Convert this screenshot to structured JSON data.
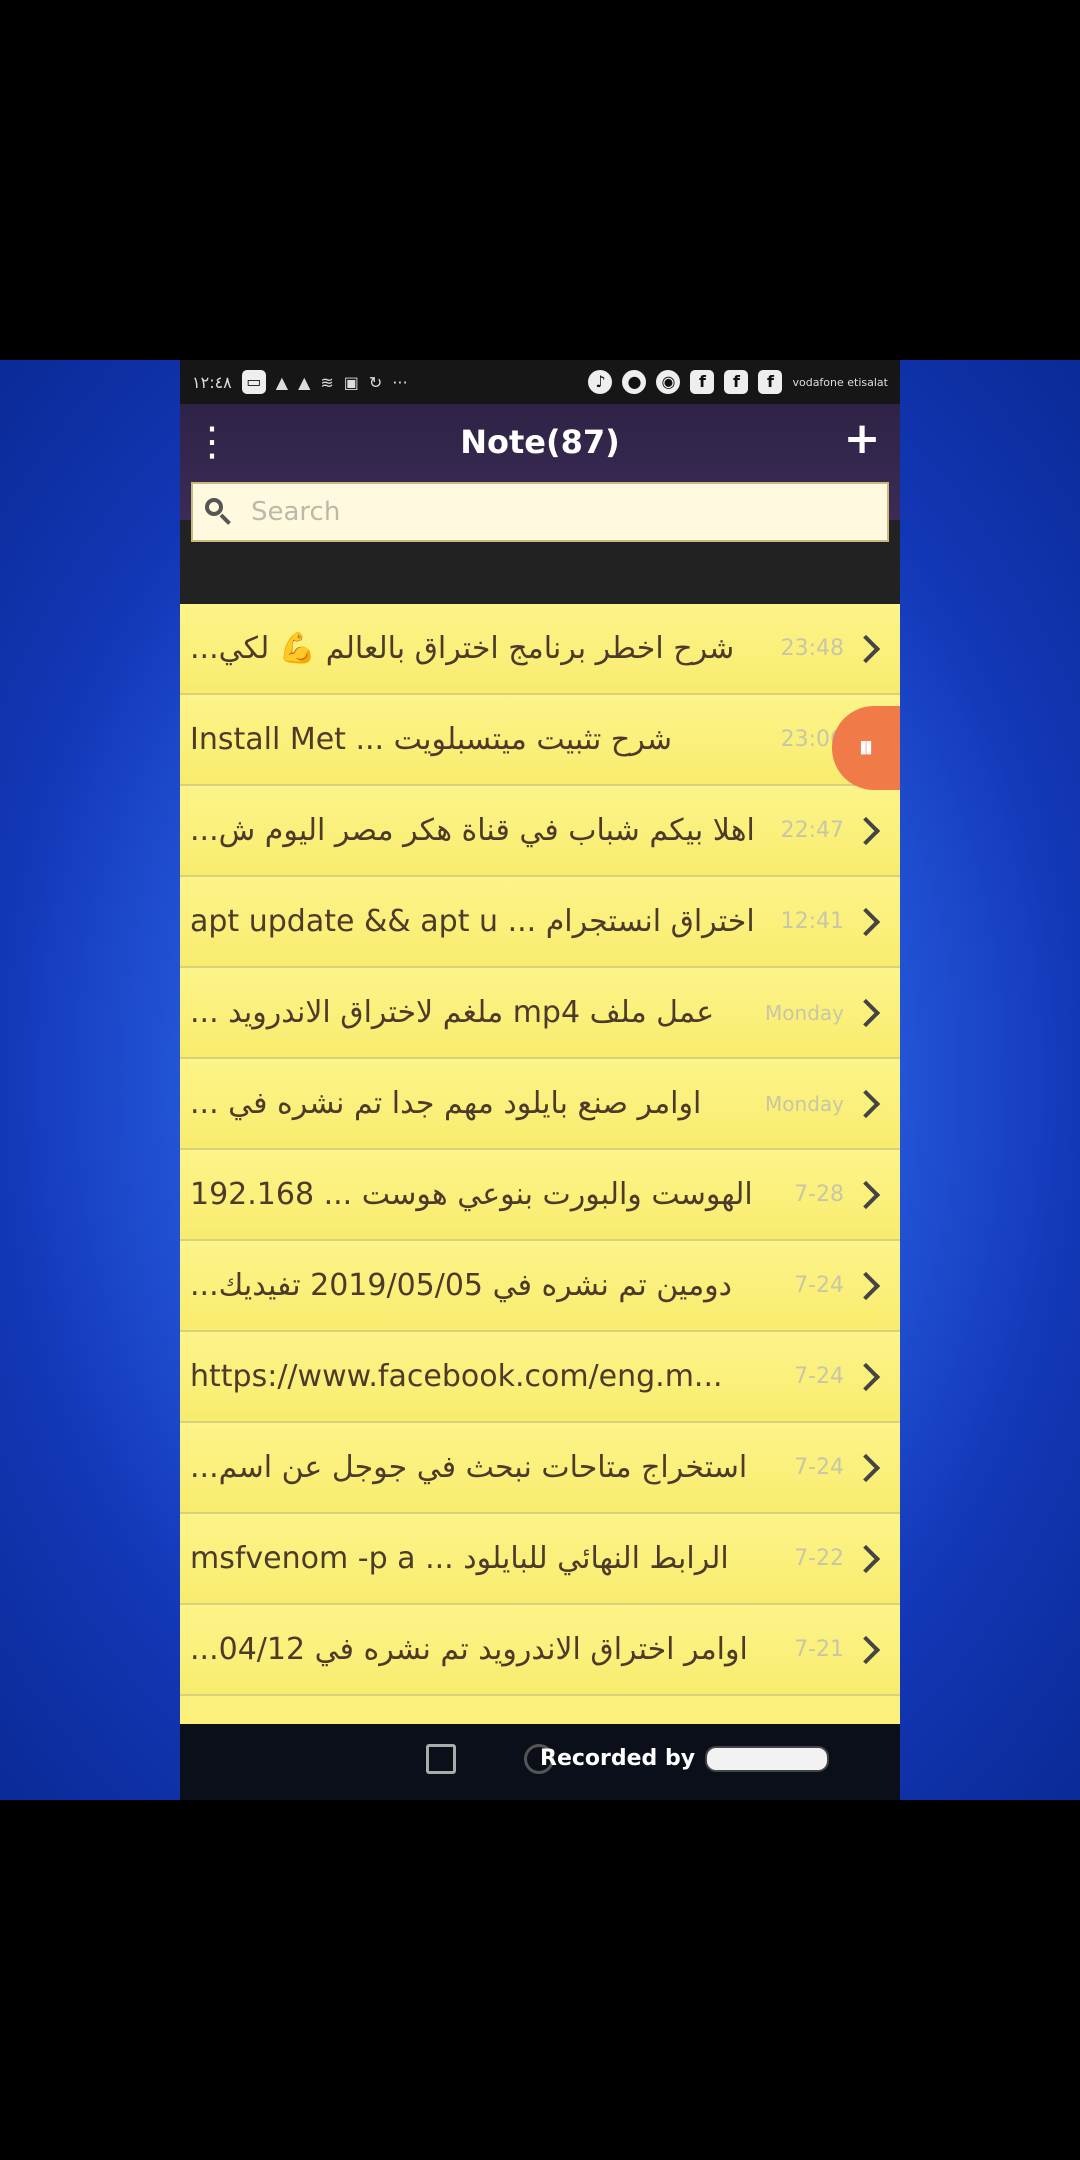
{
  "status_bar": {
    "time": "١٢:٤٨",
    "carrier": "vodafone etisalat"
  },
  "app_bar": {
    "title": "Note(87)",
    "menu_icon": "more-vert-icon",
    "add_icon": "plus-icon"
  },
  "search": {
    "placeholder": "Search",
    "value": ""
  },
  "notes": [
    {
      "text": "شرح اخطر برنامج اختراق بالعالم 💪 لكي...",
      "time": "23:48"
    },
    {
      "text": "شرح تثبيت ميتسبلويت ... Install Met",
      "time": "23:06"
    },
    {
      "text": "اهلا بيكم شباب في قناة هكر مصر اليوم ش...",
      "time": "22:47"
    },
    {
      "text": "اختراق انستجرام ... apt update && apt u",
      "time": "12:41"
    },
    {
      "text": "عمل ملف mp4 ملغم لاختراق الاندرويد ...",
      "time": "Monday"
    },
    {
      "text": "اوامر صنع بايلود مهم جدا  تم نشره في ...",
      "time": "Monday"
    },
    {
      "text": "الهوست والبورت بنوعي هوست ... 192.168",
      "time": "7-28"
    },
    {
      "text": "دومين  تم نشره في 2019/05/05  تفيديك...",
      "time": "7-24"
    },
    {
      "text": "https://www.facebook.com/eng.m...",
      "time": "7-24"
    },
    {
      "text": "استخراج متاحات نبحث في جوجل عن اسم...",
      "time": "7-24"
    },
    {
      "text": "الرابط النهائي للبايلود ... msfvenom -p a",
      "time": "7-22"
    },
    {
      "text": "اوامر اختراق الاندرويد  تم نشره في 04/12...",
      "time": "7-21"
    }
  ],
  "recording_badge": "REC",
  "nav_bar": {
    "watermark": "Recorded by"
  },
  "colors": {
    "list_bg": "#fbf07c",
    "app_bar": "#3b2b55",
    "badge": "#f07a48"
  }
}
